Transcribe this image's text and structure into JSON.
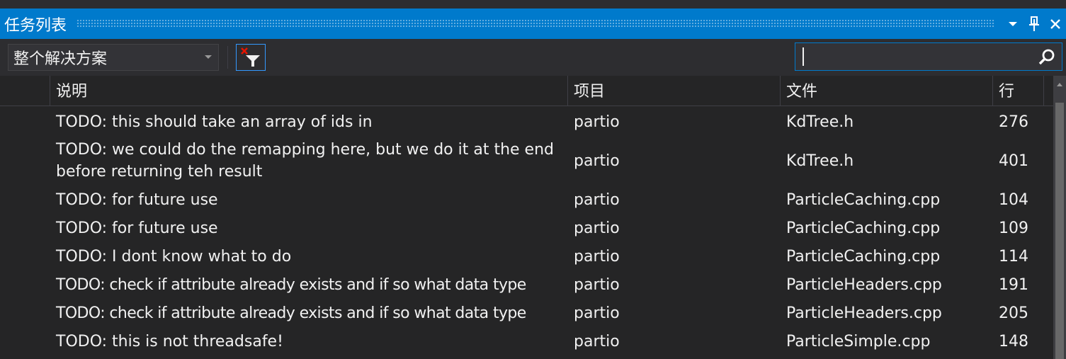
{
  "window": {
    "title": "任务列表",
    "dropdown_icon": "chevron-down-icon",
    "pin_icon": "pin-icon",
    "close_icon": "close-icon"
  },
  "toolbar": {
    "scope_value": "整个解决方案",
    "filter_icon": "clear-filter-icon",
    "search_value": "",
    "search_icon": "search-icon"
  },
  "columns": {
    "description": "说明",
    "project": "项目",
    "file": "文件",
    "line": "行"
  },
  "rows": [
    {
      "description": "TODO: this should take an array of ids in",
      "project": "partio",
      "file": "KdTree.h",
      "line": "276"
    },
    {
      "description": "TODO: we could do the remapping here, but we do it at the end before returning teh result",
      "project": "partio",
      "file": "KdTree.h",
      "line": "401"
    },
    {
      "description": "TODO: for future use",
      "project": "partio",
      "file": "ParticleCaching.cpp",
      "line": "104"
    },
    {
      "description": "TODO: for future use",
      "project": "partio",
      "file": "ParticleCaching.cpp",
      "line": "109"
    },
    {
      "description": "TODO: I dont know what to do",
      "project": "partio",
      "file": "ParticleCaching.cpp",
      "line": "114"
    },
    {
      "description": "TODO: check if attribute already exists and if so what data type",
      "project": "partio",
      "file": "ParticleHeaders.cpp",
      "line": "191"
    },
    {
      "description": "TODO: check if attribute already exists and if so what data type",
      "project": "partio",
      "file": "ParticleHeaders.cpp",
      "line": "205"
    },
    {
      "description": "TODO: this is not threadsafe!",
      "project": "partio",
      "file": "ParticleSimple.cpp",
      "line": "148"
    }
  ],
  "colors": {
    "accent": "#007acc",
    "background": "#252526",
    "toolbar": "#2d2d30",
    "text": "#f1f1f1",
    "filter_x": "#e51400"
  }
}
